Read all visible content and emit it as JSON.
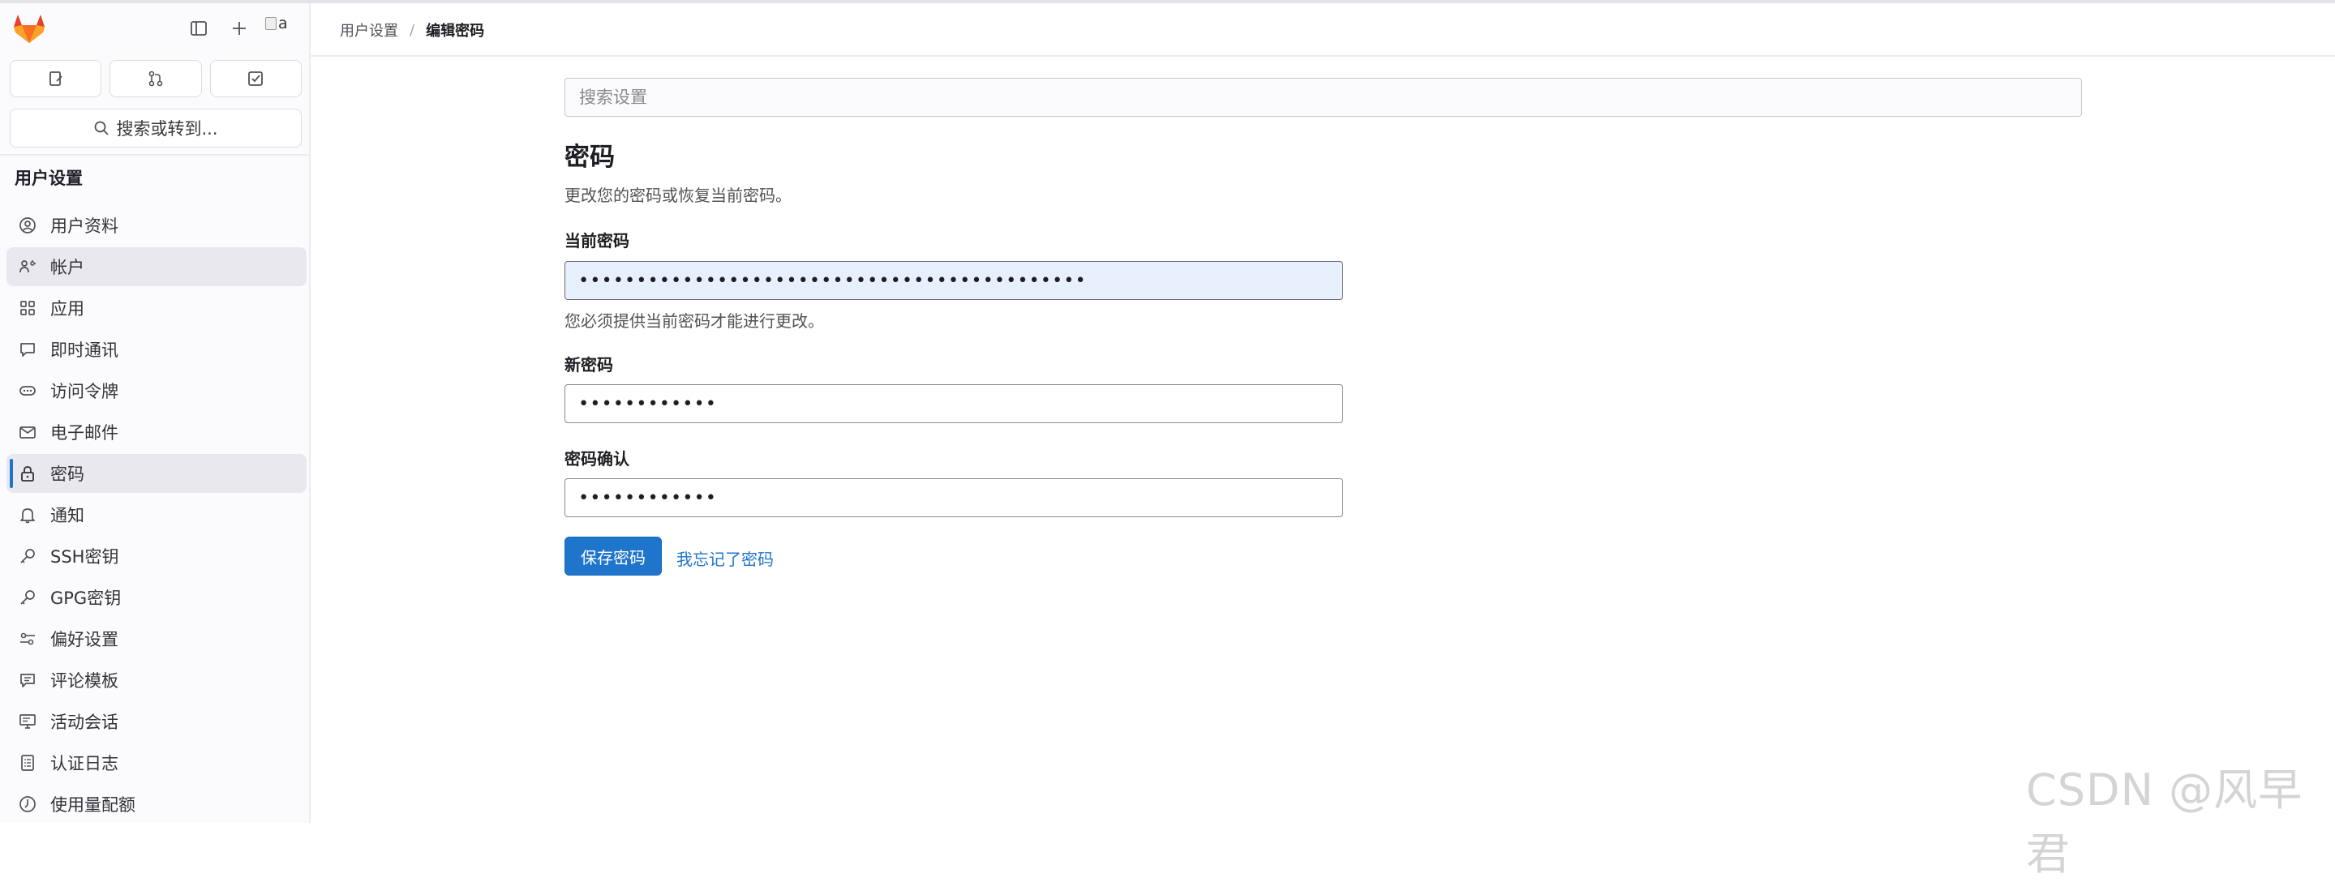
{
  "sidebar": {
    "avatar_text": "a",
    "search_label": "搜索或转到...",
    "section_title": "用户设置",
    "items": [
      {
        "label": "用户资料",
        "icon": "user-circle-icon"
      },
      {
        "label": "帐户",
        "icon": "account-icon"
      },
      {
        "label": "应用",
        "icon": "applications-icon"
      },
      {
        "label": "即时通讯",
        "icon": "chat-icon"
      },
      {
        "label": "访问令牌",
        "icon": "token-icon"
      },
      {
        "label": "电子邮件",
        "icon": "mail-icon"
      },
      {
        "label": "密码",
        "icon": "lock-icon"
      },
      {
        "label": "通知",
        "icon": "bell-icon"
      },
      {
        "label": "SSH密钥",
        "icon": "key-icon"
      },
      {
        "label": "GPG密钥",
        "icon": "key-icon"
      },
      {
        "label": "偏好设置",
        "icon": "preferences-icon"
      },
      {
        "label": "评论模板",
        "icon": "comment-template-icon"
      },
      {
        "label": "活动会话",
        "icon": "monitor-icon"
      },
      {
        "label": "认证日志",
        "icon": "log-icon"
      },
      {
        "label": "使用量配额",
        "icon": "quota-icon"
      }
    ]
  },
  "breadcrumb": {
    "parent": "用户设置",
    "separator": "/",
    "current": "编辑密码"
  },
  "main": {
    "search_placeholder": "搜索设置",
    "title": "密码",
    "description": "更改您的密码或恢复当前密码。",
    "current_password": {
      "label": "当前密码",
      "value": "••••••••••••••••••••••••••••••••••••••••••••",
      "help": "您必须提供当前密码才能进行更改。"
    },
    "new_password": {
      "label": "新密码",
      "value": "••••••••••••"
    },
    "confirm_password": {
      "label": "密码确认",
      "value": "••••••••••••"
    },
    "save_button": "保存密码",
    "forgot_link": "我忘记了密码"
  },
  "watermark": "CSDN @风早君",
  "colors": {
    "accent": "#1f75cb",
    "sidebar_bg": "#fbfafd",
    "active_bg": "#e9e8ee",
    "autofill_bg": "#e8f0fe",
    "logo_orange": "#fc6d26"
  }
}
